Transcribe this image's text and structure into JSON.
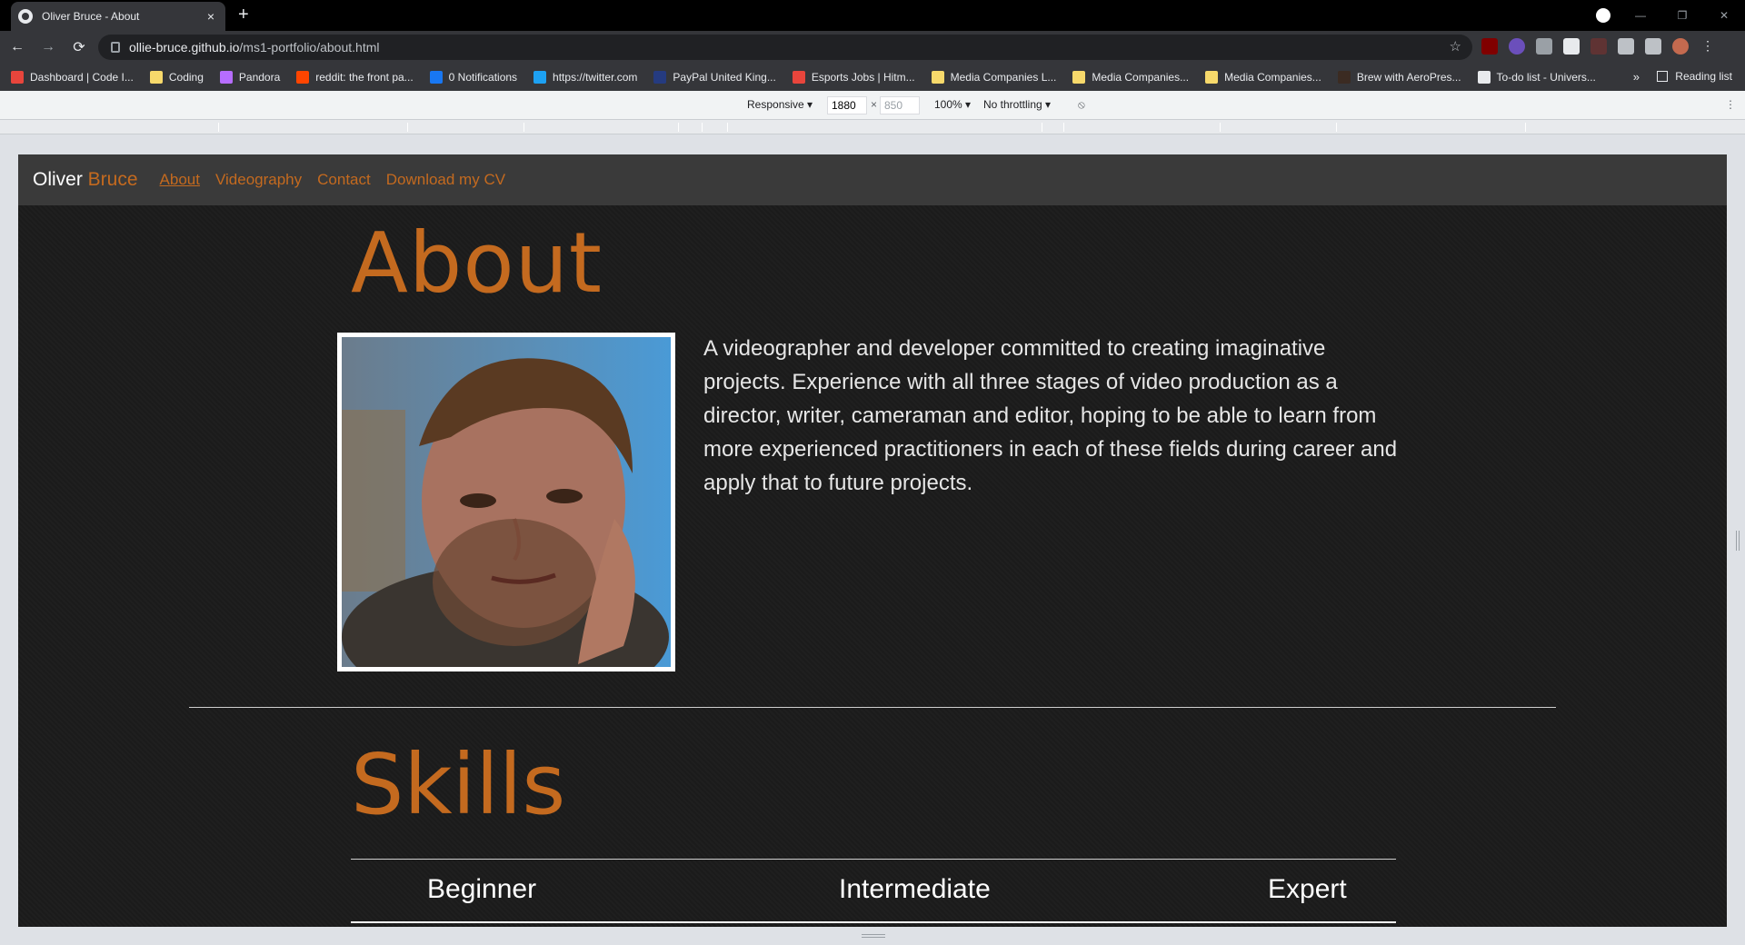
{
  "browser": {
    "tab_title": "Oliver Bruce - About",
    "tab_close": "×",
    "new_tab": "+",
    "window_controls": [
      "—",
      "❐",
      "✕"
    ],
    "url_host": "ollie-bruce.github.io",
    "url_path": "/ms1-portfolio/about.html",
    "nav": {
      "back": "←",
      "forward": "→",
      "reload": "⟳",
      "star": "☆"
    },
    "bookmarks": [
      {
        "label": "Dashboard | Code I...",
        "color": "#e8453c"
      },
      {
        "label": "Coding",
        "color": "#f7d96b"
      },
      {
        "label": "Pandora",
        "color": "#b66dff"
      },
      {
        "label": "reddit: the front pa...",
        "color": "#ff4500"
      },
      {
        "label": "0 Notifications",
        "color": "#1877f2"
      },
      {
        "label": "https://twitter.com",
        "color": "#1da1f2"
      },
      {
        "label": "PayPal United King...",
        "color": "#253b80"
      },
      {
        "label": "Esports Jobs | Hitm...",
        "color": "#e8453c"
      },
      {
        "label": "Media Companies L...",
        "color": "#f7d96b"
      },
      {
        "label": "Media Companies...",
        "color": "#f7d96b"
      },
      {
        "label": "Media Companies...",
        "color": "#f7d96b"
      },
      {
        "label": "Brew with AeroPres...",
        "color": "#3b2b22"
      },
      {
        "label": "To-do list - Univers...",
        "color": "#e8eaed"
      }
    ],
    "bookmarks_more": "»",
    "reading_list": "Reading list"
  },
  "devtools": {
    "device": "Responsive ▾",
    "width": "1880",
    "height": "850",
    "times": "×",
    "zoom": "100% ▾",
    "throttling": "No throttling ▾",
    "rotate_icon": "⦸",
    "more": "⋮"
  },
  "site": {
    "brand_first": "Oliver",
    "brand_last": " Bruce",
    "nav_links": [
      "About",
      "Videography",
      "Contact",
      "Download my CV"
    ],
    "about_heading": "About",
    "bio": "A videographer and developer committed to creating imaginative projects. Experience with all three stages of video production as a director, writer, cameraman and editor, hoping to be able to learn from more experienced practitioners in each of these fields during career and apply that to future projects.",
    "skills_heading": "Skills",
    "skill_levels": [
      "Beginner",
      "Intermediate",
      "Expert"
    ],
    "accent_color": "#c46a1f"
  }
}
